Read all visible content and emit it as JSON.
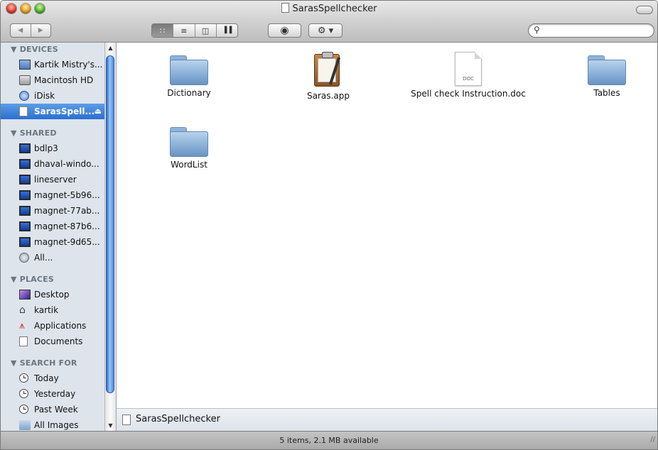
{
  "window": {
    "title": "SarasSpellchecker"
  },
  "toolbar": {
    "back_icon": "◀",
    "forward_icon": "▶",
    "view_icons": "∷",
    "view_list": "≡",
    "view_columns": "◫",
    "view_coverflow": "▐▐",
    "quicklook_icon": "◉",
    "action_icon": "⚙ ▾",
    "search": {
      "value": "",
      "placeholder": ""
    }
  },
  "sidebar": {
    "devices_header": "▼ DEVICES",
    "devices": [
      {
        "label": "Kartik Mistry's...",
        "icon": "laptop-icon"
      },
      {
        "label": "Macintosh HD",
        "icon": "hard-drive-icon"
      },
      {
        "label": "iDisk",
        "icon": "idisk-icon"
      },
      {
        "label": "SarasSpell...",
        "icon": "usb-drive-icon",
        "eject": "⏏"
      }
    ],
    "shared_header": "▼ SHARED",
    "shared": [
      {
        "label": "bdlp3"
      },
      {
        "label": "dhaval-windo..."
      },
      {
        "label": "lineserver"
      },
      {
        "label": "magnet-5b96..."
      },
      {
        "label": "magnet-77ab..."
      },
      {
        "label": "magnet-87b6..."
      },
      {
        "label": "magnet-9d65..."
      },
      {
        "label": "All..."
      }
    ],
    "places_header": "▼ PLACES",
    "places": [
      {
        "label": "Desktop"
      },
      {
        "label": "kartik",
        "glyph": "⌂"
      },
      {
        "label": "Applications",
        "glyph": "⩚"
      },
      {
        "label": "Documents"
      }
    ],
    "search_header": "▼ SEARCH FOR",
    "search_for": [
      {
        "label": "Today"
      },
      {
        "label": "Yesterday"
      },
      {
        "label": "Past Week"
      },
      {
        "label": "All Images"
      }
    ]
  },
  "files": [
    {
      "name": "Dictionary",
      "kind": "folder"
    },
    {
      "name": "Saras.app",
      "kind": "application"
    },
    {
      "name": "Spell check Instruction.doc",
      "kind": "document",
      "ext": "DOC"
    },
    {
      "name": "Tables",
      "kind": "folder"
    },
    {
      "name": "WordList",
      "kind": "folder"
    }
  ],
  "pathbar": {
    "label": "SarasSpellchecker"
  },
  "status": {
    "text": "5 items, 2.1 MB available"
  }
}
